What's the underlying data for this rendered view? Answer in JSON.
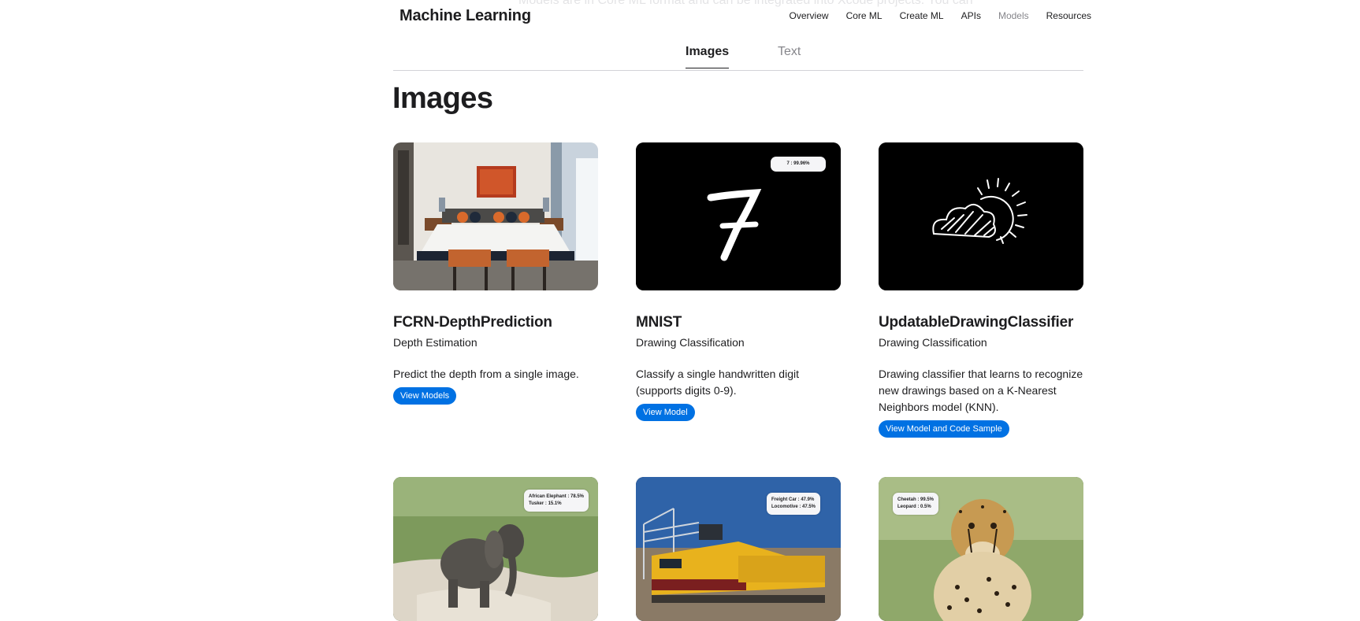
{
  "header": {
    "ghost_text": "Models are in Core ML format and can be integrated into Xcode projects. You can",
    "brand": "Machine Learning",
    "nav": [
      {
        "label": "Overview",
        "current": false
      },
      {
        "label": "Core ML",
        "current": false
      },
      {
        "label": "Create ML",
        "current": false
      },
      {
        "label": "APIs",
        "current": false
      },
      {
        "label": "Models",
        "current": true
      },
      {
        "label": "Resources",
        "current": false
      }
    ]
  },
  "tabs": {
    "images": "Images",
    "text": "Text"
  },
  "section": {
    "title": "Images"
  },
  "cards": [
    {
      "title": "FCRN-DepthPrediction",
      "subtitle": "Depth Estimation",
      "description": "Predict the depth from a single image.",
      "button": "View Models",
      "image": "bedroom-photo"
    },
    {
      "title": "MNIST",
      "subtitle": "Drawing Classification",
      "description": "Classify a single handwritten digit (supports digits 0-9).",
      "button": "View Model",
      "image": "handwritten-seven",
      "overlay": [
        "7 : 99.96%"
      ]
    },
    {
      "title": "UpdatableDrawingClassifier",
      "subtitle": "Drawing Classification",
      "description": "Drawing classifier that learns to recognize new drawings based on a K-Nearest Neighbors model (KNN).",
      "button": "View Model and Code Sample",
      "image": "sun-cloud-drawing"
    },
    {
      "image": "elephant-photo",
      "overlay": [
        "African Elephant : 78.5%",
        "Tusker : 15.1%"
      ]
    },
    {
      "image": "train-photo",
      "overlay": [
        "Freight Car : 47.9%",
        "Locomotive : 47.5%"
      ]
    },
    {
      "image": "cheetah-photo",
      "overlay": [
        "Cheetah : 99.5%",
        "Leopard : 0.5%"
      ]
    }
  ]
}
